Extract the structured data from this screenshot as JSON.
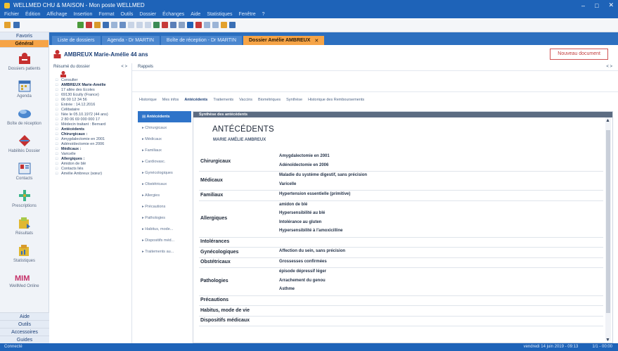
{
  "window": {
    "title": "WELLMED CHU & MAISON - Mon poste WELLMED",
    "minimize_glyph": "–",
    "maximize_glyph": "□",
    "close_glyph": "✕"
  },
  "menu": [
    "Fichier",
    "Édition",
    "Affichage",
    "Insertion",
    "Format",
    "Outils",
    "Dossier",
    "Échanges",
    "Aide",
    "Statistiques",
    "Fenêtre",
    "?"
  ],
  "tabs": [
    {
      "label": "Liste de dossiers"
    },
    {
      "label": "Agenda - Dr MARTIN"
    },
    {
      "label": "Boîte de réception - Dr MARTIN"
    },
    {
      "label": "Dossier Amélie AMBREUX",
      "active": true
    }
  ],
  "sidebar": {
    "top_tabs": [
      "Favoris",
      "Général"
    ],
    "items": [
      {
        "label": "Dossiers patients",
        "icon": "patient-folder-icon"
      },
      {
        "label": "Agenda",
        "icon": "calendar-icon"
      },
      {
        "label": "Boîte de réception",
        "icon": "inbox-icon"
      },
      {
        "label": "Habilités Dossier",
        "icon": "permissions-icon"
      },
      {
        "label": "Contacts",
        "icon": "contacts-icon"
      },
      {
        "label": "Prescriptions",
        "icon": "prescriptions-icon"
      },
      {
        "label": "Résultats",
        "icon": "results-icon"
      },
      {
        "label": "Statistiques",
        "icon": "statistics-icon"
      },
      {
        "label": "WellMed Online",
        "icon": "mim-logo"
      }
    ],
    "bottom": [
      "Aide",
      "Outils",
      "Accessoires",
      "Guides"
    ]
  },
  "patient": {
    "header_name": "AMBREUX Marie-Amélie 44 ans",
    "new_button": "Nouveau document",
    "info_panel_title": "Résumé du dossier",
    "info_panel_controls": "< >",
    "info_lines": [
      {
        "text": "Consulter",
        "bold": false
      },
      {
        "text": "AMBREUX Marie-Amélie",
        "bold": true
      },
      {
        "text": "17 allée des Écoles",
        "bold": false
      },
      {
        "text": "69130 Écully (France)",
        "bold": false
      },
      {
        "text": "06 00 12 34 56",
        "bold": false
      },
      {
        "text": "Entrée : 14.12.2016",
        "bold": false
      },
      {
        "text": "Célibataire",
        "bold": false
      },
      {
        "text": "Née le 05.10.1972 (44 ans)",
        "bold": false
      },
      {
        "text": "2 80 06 69 000 000 17",
        "bold": false
      },
      {
        "text": "Médecin traitant : Bernard",
        "bold": false
      },
      {
        "text": "Antécédents",
        "bold": true
      },
      {
        "text": "Chirurgicaux :",
        "bold": true
      },
      {
        "text": "Amygdalectomie en 2001",
        "bold": false
      },
      {
        "text": "Adénoïdectomie en 2006",
        "bold": false
      },
      {
        "text": "Médicaux :",
        "bold": true
      },
      {
        "text": "Varicelle",
        "bold": false
      },
      {
        "text": "Allergiques :",
        "bold": true
      },
      {
        "text": "Amidon de blé",
        "bold": false
      },
      {
        "text": "Contacts liés",
        "bold": false
      },
      {
        "text": "Amélie Ambreux (sœur)",
        "bold": false
      }
    ]
  },
  "right_panel": {
    "label": "Rappels",
    "controls": "< >"
  },
  "subtabs": [
    {
      "label": "Historique",
      "active": false
    },
    {
      "label": "Mes infos",
      "active": false
    },
    {
      "label": "Antécédents",
      "active": true
    },
    {
      "label": "Traitements",
      "active": false
    },
    {
      "label": "Vaccins",
      "active": false
    },
    {
      "label": "Biométriques",
      "active": false
    },
    {
      "label": "Synthèse",
      "active": false
    },
    {
      "label": "Historique des Remboursements",
      "active": false
    }
  ],
  "categories": [
    {
      "label": "Antécédents",
      "active": true
    },
    {
      "label": "Chirurgicaux"
    },
    {
      "label": "Médicaux"
    },
    {
      "label": "Familiaux"
    },
    {
      "label": "Cardiovasc."
    },
    {
      "label": "Gynécologiques"
    },
    {
      "label": "Obstétricaux"
    },
    {
      "label": "Allergies"
    },
    {
      "label": "Précautions"
    },
    {
      "label": "Pathologies"
    },
    {
      "label": "Habitus, mode..."
    },
    {
      "label": "Dispositifs méd..."
    },
    {
      "label": "Traitements au..."
    }
  ],
  "document": {
    "header": "Synthèse des antécédents",
    "title": "ANTÉCÉDENTS",
    "subtitle": "MARIE AMÉLIE AMBREUX",
    "rows": [
      {
        "category": "Chirurgicaux",
        "values": [
          "Amygdalectomie en 2001",
          "Adénoïdectomie en 2006"
        ]
      },
      {
        "category": "Médicaux",
        "values": [
          "Maladie du système digestif, sans précision",
          "Varicelle"
        ]
      },
      {
        "category": "Familiaux",
        "values": [
          "Hypertension essentielle (primitive)"
        ]
      },
      {
        "category": "Allergiques",
        "values": [
          "amidon de blé",
          "Hypersensibilité au blé",
          "Intolérance au gluten",
          "Hypersensibilité à l'amoxicilline"
        ]
      },
      {
        "category": "Intolérances",
        "values": []
      },
      {
        "category": "Gynécologiques",
        "values": [
          "Affection du sein, sans précision"
        ]
      },
      {
        "category": "Obstétricaux",
        "values": [
          "Grossesses confirmées"
        ]
      },
      {
        "category": "Pathologies",
        "values": [
          "épisode dépressif léger",
          "Arrachement du genou",
          "Asthme"
        ]
      },
      {
        "category": "Précautions",
        "values": []
      },
      {
        "category": "Habitus, mode de vie",
        "values": []
      },
      {
        "category": "Dispositifs médicaux",
        "values": []
      }
    ]
  },
  "statusbar": {
    "left": "Connecté",
    "date": "vendredi 14 juin 2019 - 09:13",
    "right": "1/1 - 00:00"
  }
}
